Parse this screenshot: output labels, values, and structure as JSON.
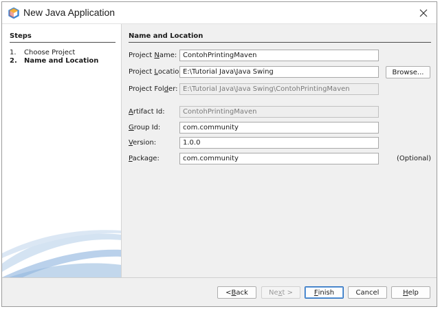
{
  "window": {
    "title": "New Java Application",
    "icon": "netbeans-cube-icon",
    "close_icon": "close-icon"
  },
  "steps": {
    "heading": "Steps",
    "items": [
      {
        "number": "1.",
        "label": "Choose Project",
        "active": false
      },
      {
        "number": "2.",
        "label": "Name and Location",
        "active": true
      }
    ]
  },
  "panel": {
    "heading": "Name and Location",
    "project_name": {
      "label": "Project Name:",
      "mnemonic": "N",
      "value": "ContohPrintingMaven"
    },
    "project_location": {
      "label": "Project Location:",
      "mnemonic": "L",
      "value": "E:\\Tutorial Java\\Java Swing"
    },
    "browse_button": "Browse...",
    "project_folder": {
      "label": "Project Folder:",
      "mnemonic": "d",
      "value": "E:\\Tutorial Java\\Java Swing\\ContohPrintingMaven"
    },
    "artifact_id": {
      "label": "Artifact Id:",
      "mnemonic": "A",
      "value": "ContohPrintingMaven"
    },
    "group_id": {
      "label": "Group Id:",
      "mnemonic": "G",
      "value": "com.community"
    },
    "version": {
      "label": "Version:",
      "mnemonic": "V",
      "value": "1.0.0"
    },
    "package": {
      "label": "Package:",
      "mnemonic": "P",
      "value": "com.community",
      "hint": "(Optional)"
    }
  },
  "footer": {
    "back": "< Back",
    "next": "Next >",
    "finish": "Finish",
    "cancel": "Cancel",
    "help": "Help"
  },
  "colors": {
    "dialog_bg": "#f0f0f0",
    "primary_border": "#2b6fbd",
    "icon_orange": "#f5a623",
    "icon_blue": "#3b87d6",
    "swoosh": "#8fb6dd"
  }
}
